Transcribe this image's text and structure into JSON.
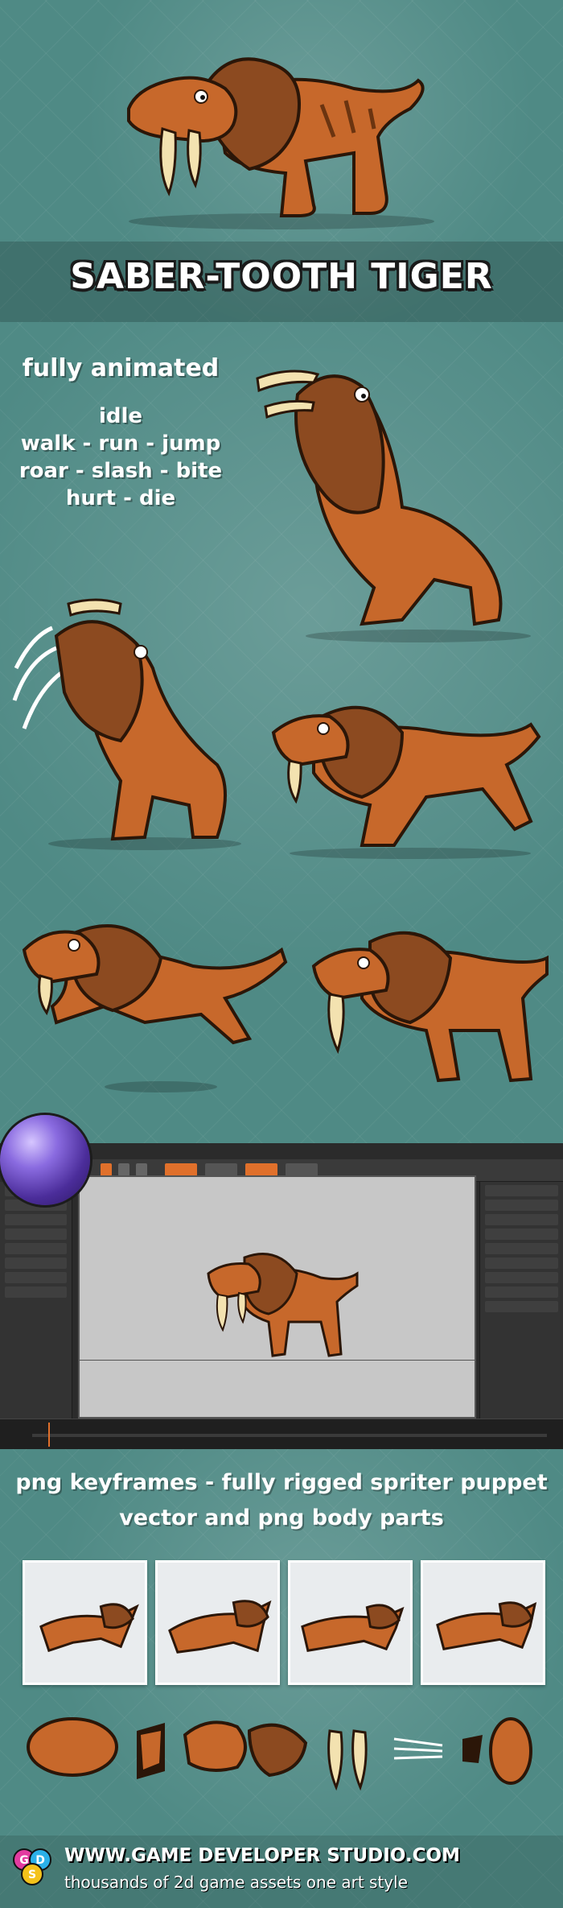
{
  "title": "SABER-TOOTH TIGER",
  "animations": {
    "heading": "fully animated",
    "lines": [
      "idle",
      "walk - run - jump",
      "roar - slash - bite",
      "hurt - die"
    ]
  },
  "features": {
    "line1": "png keyframes - fully rigged spriter puppet",
    "line2": "vector and png body parts"
  },
  "footer": {
    "url": "WWW.GAME DEVELOPER STUDIO.COM",
    "tagline": "thousands of 2d game assets one art style",
    "logo_letters": [
      "G",
      "D",
      "S"
    ]
  },
  "colors": {
    "background": "#4f8a85",
    "tiger_fur": "#c7682b",
    "tiger_mane": "#8c4a20",
    "fang": "#f3e2b0",
    "editor_bg": "#2b2b2b",
    "canvas_bg": "#c7c7c7",
    "accent": "#e0702b"
  }
}
